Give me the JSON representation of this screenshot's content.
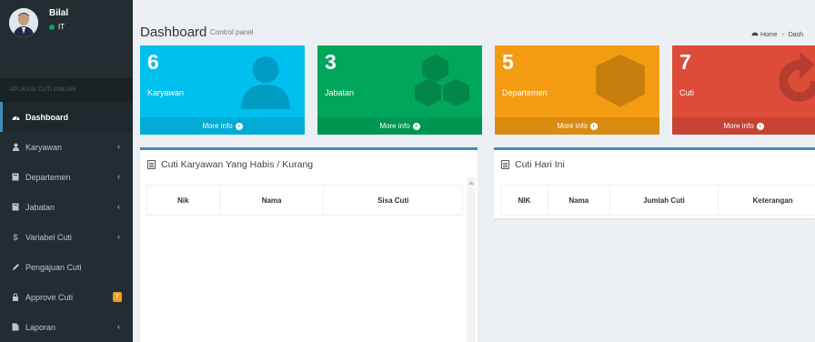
{
  "user": {
    "name": "Bilal",
    "status": "IT"
  },
  "sidebar": {
    "header": "APLIKASI CUTI ONLINE",
    "items": [
      {
        "label": "Dashboard",
        "icon": "dashboard-icon",
        "active": true
      },
      {
        "label": "Karyawan",
        "icon": "users-icon",
        "chevron": "‹"
      },
      {
        "label": "Departemen",
        "icon": "book-icon",
        "chevron": "‹"
      },
      {
        "label": "Jabatan",
        "icon": "book-icon",
        "chevron": "‹"
      },
      {
        "label": "Variabel Cuti",
        "icon": "dollar-icon",
        "chevron": "‹"
      },
      {
        "label": "Pengajuan Cuti",
        "icon": "edit-icon"
      },
      {
        "label": "Approve Cuti",
        "icon": "lock-icon",
        "badge": "7"
      },
      {
        "label": "Laporan",
        "icon": "file-icon",
        "chevron": "‹"
      }
    ]
  },
  "header": {
    "title": "Dashboard",
    "subtitle": "Control panel",
    "breadcrumb_home": "Home",
    "breadcrumb_current": "Dash"
  },
  "boxes": [
    {
      "number": "6",
      "label": "Karyawan",
      "footer": "More info",
      "color": "#00c0ef",
      "icon": "user-icon"
    },
    {
      "number": "3",
      "label": "Jabatan",
      "footer": "More info",
      "color": "#00a65a",
      "icon": "cubes-icon"
    },
    {
      "number": "5",
      "label": "Departemen",
      "footer": "More info",
      "color": "#f39c12",
      "icon": "cube-icon"
    },
    {
      "number": "7",
      "label": "Cuti",
      "footer": "More info",
      "color": "#dd4b39",
      "icon": "refresh-icon"
    }
  ],
  "panel_left": {
    "title": "Cuti Karyawan Yang Habis / Kurang",
    "columns": [
      "Nik",
      "Nama",
      "Sisa Cuti"
    ]
  },
  "panel_right": {
    "title": "Cuti Hari Ini",
    "columns": [
      "NIK",
      "Nama",
      "Jumlah Cuti",
      "Keterangan"
    ]
  }
}
